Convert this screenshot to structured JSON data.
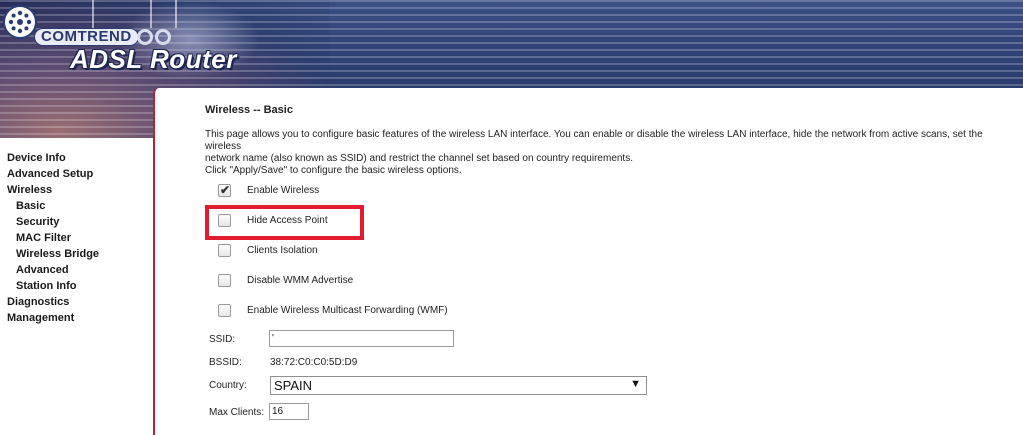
{
  "header": {
    "brand": "COMTREND",
    "product": "ADSL Router"
  },
  "sidebar": {
    "items": [
      {
        "label": "Device Info",
        "level": 0
      },
      {
        "label": "Advanced Setup",
        "level": 0
      },
      {
        "label": "Wireless",
        "level": 0
      },
      {
        "label": "Basic",
        "level": 1
      },
      {
        "label": "Security",
        "level": 1
      },
      {
        "label": "MAC Filter",
        "level": 1
      },
      {
        "label": "Wireless Bridge",
        "level": 1
      },
      {
        "label": "Advanced",
        "level": 1
      },
      {
        "label": "Station Info",
        "level": 1
      },
      {
        "label": "Diagnostics",
        "level": 0
      },
      {
        "label": "Management",
        "level": 0
      }
    ]
  },
  "main": {
    "title": "Wireless -- Basic",
    "description_line1": "This page allows you to configure basic features of the wireless LAN interface. You can enable or disable the wireless LAN interface, hide the network from active scans, set the wireless",
    "description_line2": "network name (also known as SSID) and restrict the channel set based on country requirements.",
    "description_line3": "Click \"Apply/Save\" to configure the basic wireless options.",
    "options": [
      {
        "label": "Enable Wireless",
        "checked": true
      },
      {
        "label": "Hide Access Point",
        "checked": false
      },
      {
        "label": "Clients Isolation",
        "checked": false
      },
      {
        "label": "Disable WMM Advertise",
        "checked": false
      },
      {
        "label": "Enable Wireless Multicast Forwarding (WMF)",
        "checked": false
      }
    ],
    "ssid_label": "SSID:",
    "ssid_value": "'",
    "bssid_label": "BSSID:",
    "bssid_value": "38:72:C0:C0:5D:D9",
    "country_label": "Country:",
    "country_value": "SPAIN",
    "max_clients_label": "Max Clients:",
    "max_clients_value": "16"
  },
  "colors": {
    "accent": "#b5232b",
    "highlight": "#e21b2e",
    "banner": "#2c3e70"
  }
}
